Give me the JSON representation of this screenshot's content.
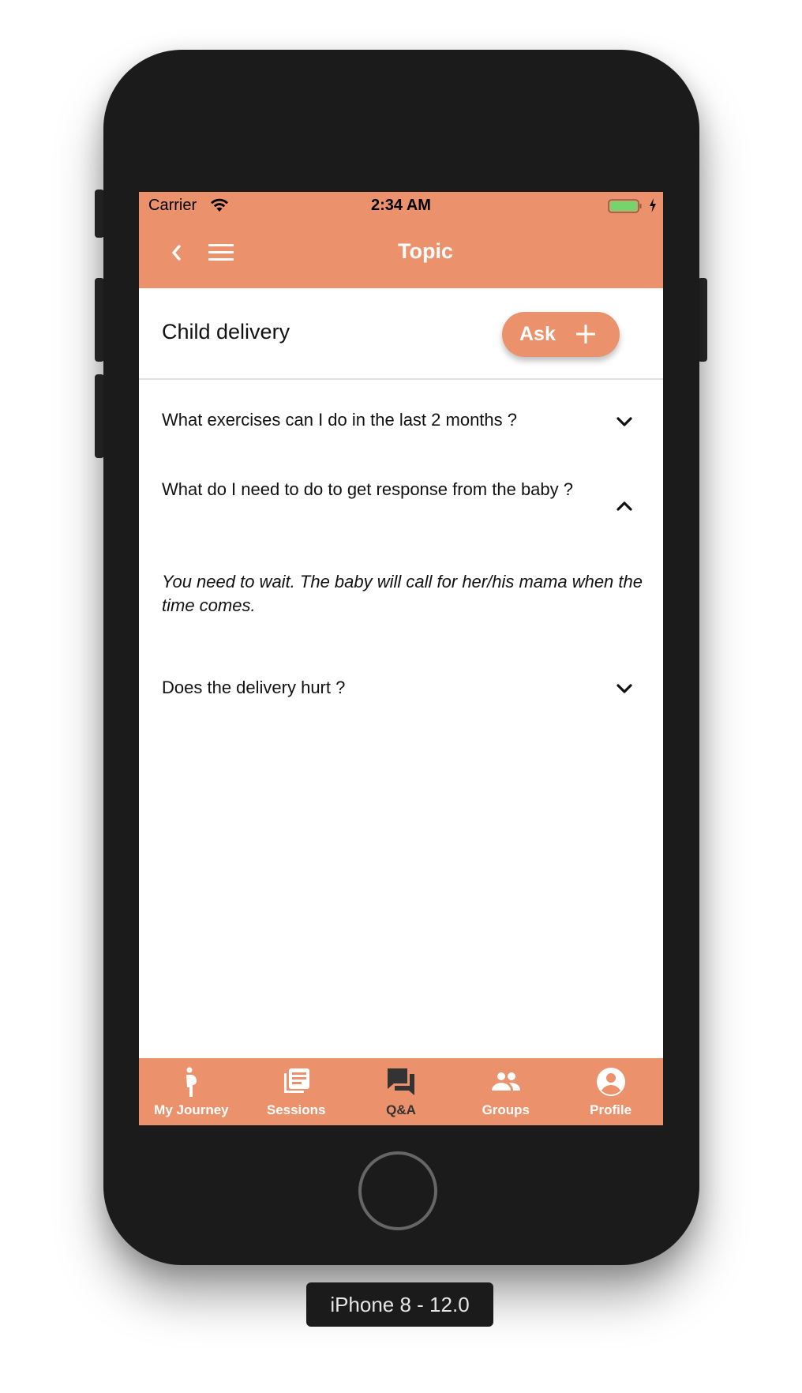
{
  "status_bar": {
    "carrier": "Carrier",
    "time": "2:34 AM",
    "wifi_icon": "wifi-icon",
    "battery_icon": "battery-charging-icon",
    "battery_color": "#76d46d"
  },
  "navbar": {
    "title": "Topic",
    "back_icon": "chevron-left-icon",
    "menu_icon": "hamburger-menu-icon"
  },
  "topic": {
    "title": "Child delivery",
    "ask_button_label": "Ask",
    "ask_button_icon": "plus-icon"
  },
  "qa_items": [
    {
      "question": "What exercises can I do in the last 2 months ?",
      "expanded": false,
      "icon": "chevron-down-icon"
    },
    {
      "question": "What do I need to do to get response from the baby ?",
      "expanded": true,
      "icon": "chevron-up-icon",
      "answer": "You need to wait. The baby will call for her/his mama when the time comes."
    },
    {
      "question": "Does the delivery hurt ?",
      "expanded": false,
      "icon": "chevron-down-icon"
    }
  ],
  "tabbar": {
    "active": "Q&A",
    "tabs": [
      {
        "label": "My Journey",
        "icon": "pregnant-woman-icon"
      },
      {
        "label": "Sessions",
        "icon": "library-books-icon"
      },
      {
        "label": "Q&A",
        "icon": "forum-icon"
      },
      {
        "label": "Groups",
        "icon": "people-icon"
      },
      {
        "label": "Profile",
        "icon": "account-circle-icon"
      }
    ]
  },
  "device": {
    "label": "iPhone 8 - 12.0"
  },
  "colors": {
    "accent": "#eb916b",
    "active_tab": "#333333",
    "phone_body": "#1b1b1b"
  }
}
